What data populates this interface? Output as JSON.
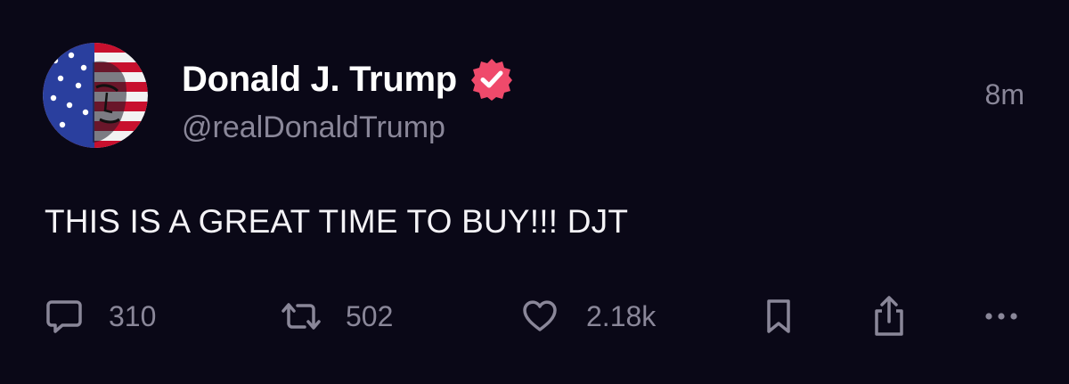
{
  "post": {
    "author": {
      "display_name": "Donald J. Trump",
      "handle": "@realDonaldTrump",
      "verified": true,
      "avatar_icon": "flag-portrait-avatar"
    },
    "timestamp": "8m",
    "text": "THIS IS A GREAT TIME TO BUY!!! DJT",
    "actions": {
      "reply": {
        "icon": "reply-icon",
        "count": "310"
      },
      "repost": {
        "icon": "repost-icon",
        "count": "502"
      },
      "like": {
        "icon": "heart-icon",
        "count": "2.18k"
      },
      "bookmark": {
        "icon": "bookmark-icon"
      },
      "share": {
        "icon": "share-icon"
      },
      "more": {
        "icon": "more-icon"
      }
    }
  },
  "colors": {
    "background": "#0a0817",
    "text_primary": "#ffffff",
    "text_secondary": "#8a8799",
    "verified_badge": "#ef4a6b"
  }
}
